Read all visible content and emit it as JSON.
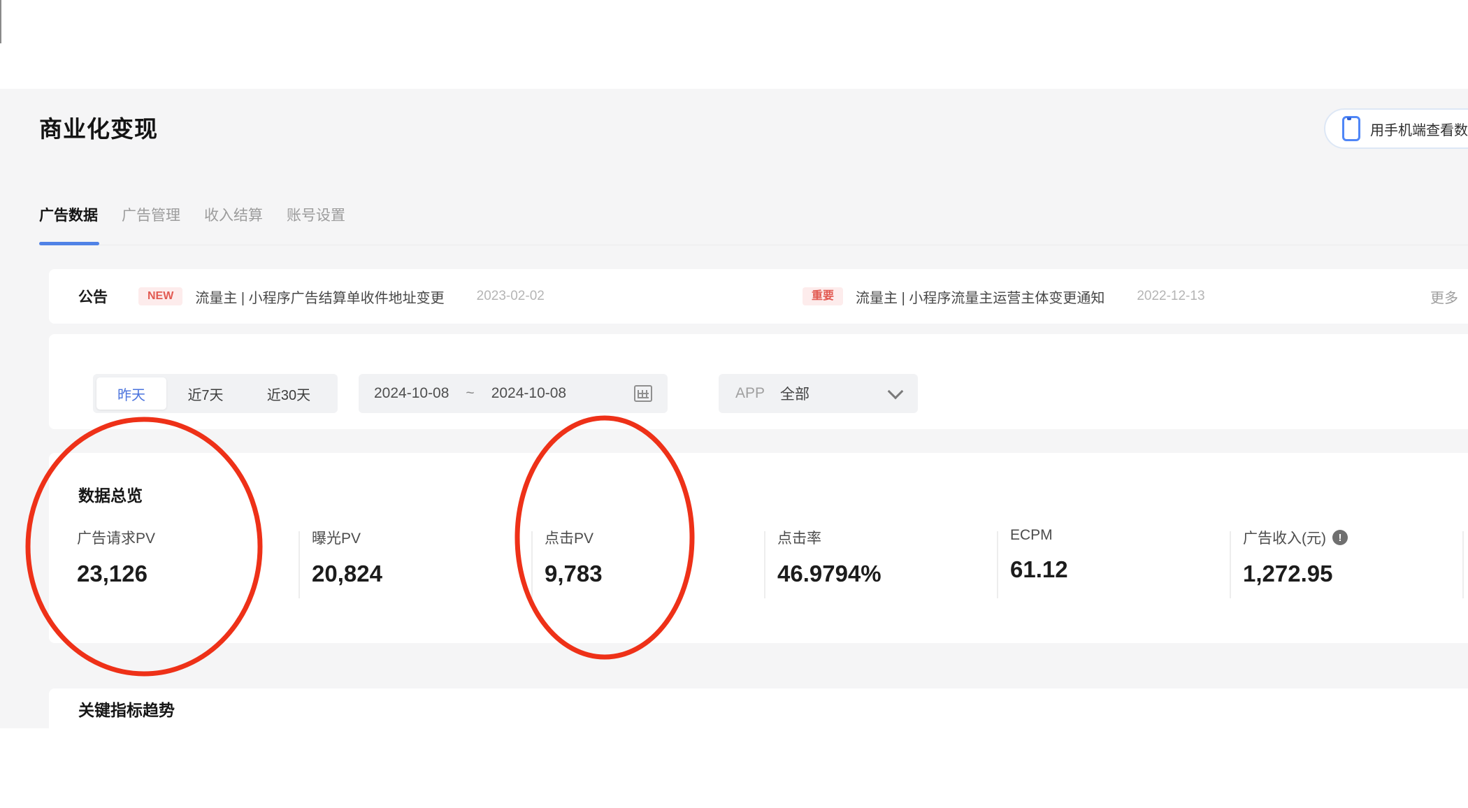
{
  "page": {
    "title": "商业化变现"
  },
  "toolbar": {
    "mobile_view_label": "用手机端查看数据"
  },
  "tabs": [
    {
      "label": "广告数据",
      "active": true
    },
    {
      "label": "广告管理",
      "active": false
    },
    {
      "label": "收入结算",
      "active": false
    },
    {
      "label": "账号设置",
      "active": false
    }
  ],
  "announcement": {
    "heading": "公告",
    "more_label": "更多",
    "items": [
      {
        "badge": "NEW",
        "text": "流量主 | 小程序广告结算单收件地址变更",
        "date": "2023-02-02"
      },
      {
        "badge": "重要",
        "text": "流量主 | 小程序流量主运营主体变更通知",
        "date": "2022-12-13"
      }
    ]
  },
  "filters": {
    "quick_ranges": [
      {
        "label": "昨天",
        "active": true
      },
      {
        "label": "近7天",
        "active": false
      },
      {
        "label": "近30天",
        "active": false
      }
    ],
    "date_start": "2024-10-08",
    "date_separator": "~",
    "date_end": "2024-10-08",
    "app_label": "APP",
    "app_value": "全部"
  },
  "overview": {
    "title": "数据总览",
    "metrics": [
      {
        "label": "广告请求PV",
        "value": "23,126",
        "circled": true
      },
      {
        "label": "曝光PV",
        "value": "20,824",
        "circled": false
      },
      {
        "label": "点击PV",
        "value": "9,783",
        "circled": true
      },
      {
        "label": "点击率",
        "value": "46.9794%",
        "circled": false
      },
      {
        "label": "ECPM",
        "value": "61.12",
        "circled": false
      },
      {
        "label": "广告收入(元)",
        "value": "1,272.95",
        "has_info_icon": true,
        "info_glyph": "!",
        "circled": false
      }
    ]
  },
  "trends": {
    "title": "关键指标趋势"
  },
  "annotation": {
    "shape": "ellipse",
    "color": "#ee3118",
    "targets": [
      "广告请求PV 23,126",
      "点击PV 9,783"
    ]
  },
  "colors": {
    "accent_blue": "#5082e6",
    "badge_red": "#e25a52",
    "badge_bg": "#fdecec",
    "panel_gray": "#f5f5f6",
    "phone_icon_blue": "#4f86f7"
  }
}
